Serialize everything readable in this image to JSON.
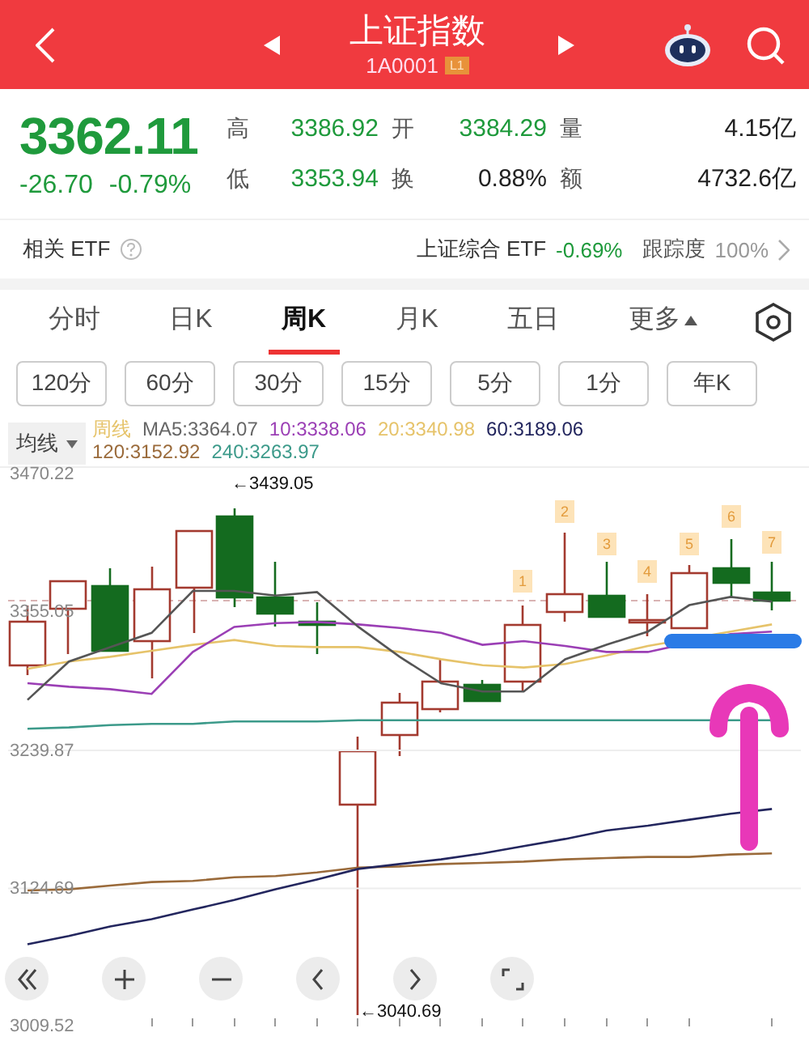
{
  "header": {
    "title": "上证指数",
    "code": "1A0001",
    "level_badge": "L1"
  },
  "quote": {
    "price": "3362.11",
    "change": "-26.70",
    "change_pct": "-0.79%",
    "color": "#1f9a3c",
    "stats": [
      {
        "label": "高",
        "value": "3386.92",
        "color": "#1f9a3c"
      },
      {
        "label": "开",
        "value": "3384.29",
        "color": "#1f9a3c"
      },
      {
        "label": "量",
        "value": "4.15亿",
        "color": "#222222"
      },
      {
        "label": "低",
        "value": "3353.94",
        "color": "#1f9a3c"
      },
      {
        "label": "换",
        "value": "0.88%",
        "color": "#222222"
      },
      {
        "label": "额",
        "value": "4732.6亿",
        "color": "#222222"
      }
    ]
  },
  "etf": {
    "label": "相关 ETF",
    "fund": "上证综合 ETF",
    "fund_change": "-0.69%",
    "tracking_label": "跟踪度",
    "tracking": "100%"
  },
  "period_tabs": [
    {
      "label": "分时",
      "selected": false
    },
    {
      "label": "日K",
      "selected": false
    },
    {
      "label": "周K",
      "selected": true
    },
    {
      "label": "月K",
      "selected": false
    },
    {
      "label": "五日",
      "selected": false
    },
    {
      "label": "更多",
      "selected": false,
      "kind": "menu"
    }
  ],
  "interval_tabs": [
    "120分",
    "60分",
    "30分",
    "15分",
    "5分",
    "1分",
    "年K"
  ],
  "ma_legend": {
    "selector": "均线",
    "items": [
      {
        "text": "周线",
        "color": "#e6c36a"
      },
      {
        "text": "MA5:3364.07",
        "color": "#666666"
      },
      {
        "text": "10:3338.06",
        "color": "#9b3fb5"
      },
      {
        "text": "20:3340.98",
        "color": "#e6c36a"
      },
      {
        "text": "60:3189.06",
        "color": "#23265e"
      },
      {
        "text": "120:3152.92",
        "color": "#9a6a3a"
      },
      {
        "text": "240:3263.97",
        "color": "#3c9a8a"
      }
    ]
  },
  "chart": {
    "chart_data": {
      "type": "line",
      "ylim": [
        3009.52,
        3470.22
      ],
      "yticks": [
        {
          "value": 3470.22,
          "label": "3470.22"
        },
        {
          "value": 3355.05,
          "label": "3355.05"
        },
        {
          "value": 3239.87,
          "label": "3239.87"
        },
        {
          "value": 3124.69,
          "label": "3124.69"
        },
        {
          "value": 3009.52,
          "label": "3009.52"
        }
      ],
      "series": [
        {
          "color": "#3c9a8a",
          "values": [
            3258,
            3259,
            3261,
            3262,
            3262,
            3264,
            3264,
            3264,
            3265,
            3265,
            3265,
            3265,
            3265,
            3265,
            3265,
            3265,
            3265,
            3265,
            3265
          ]
        },
        {
          "color": "#9a6a3a",
          "values": [
            3123,
            3124,
            3127,
            3130,
            3131,
            3134,
            3135,
            3138,
            3142,
            3143,
            3145,
            3146,
            3147,
            3149,
            3150,
            3151,
            3151,
            3153,
            3154
          ]
        },
        {
          "color": "#23265e",
          "values": [
            3078,
            3085,
            3093,
            3099,
            3107,
            3115,
            3124,
            3132,
            3141,
            3145,
            3149,
            3154,
            3160,
            3166,
            3173,
            3177,
            3182,
            3187,
            3191
          ]
        },
        {
          "color": "#e6c36a",
          "values": [
            3308,
            3314,
            3318,
            3323,
            3328,
            3332,
            3327,
            3326,
            3326,
            3322,
            3316,
            3311,
            3309,
            3312,
            3319,
            3327,
            null,
            3339,
            3345
          ]
        },
        {
          "color": "#9b3fb5",
          "values": [
            3296,
            3293,
            3291,
            3287,
            3322,
            3343,
            3346,
            3347,
            3345,
            3342,
            3338,
            3328,
            3331,
            3327,
            3322,
            3322,
            null,
            3337,
            3339
          ]
        },
        {
          "color": "#555555",
          "values": [
            3282,
            3314,
            3326,
            3338,
            3373,
            3373,
            3369,
            3372,
            3343,
            3318,
            3296,
            3289,
            3289,
            3316,
            3328,
            3339,
            3361,
            3368,
            3364
          ]
        }
      ]
    },
    "high_label": "←3439.05",
    "low_label": "←3040.69",
    "event_markers": [
      "1",
      "2",
      "3",
      "4",
      "5",
      "6",
      "7"
    ]
  }
}
